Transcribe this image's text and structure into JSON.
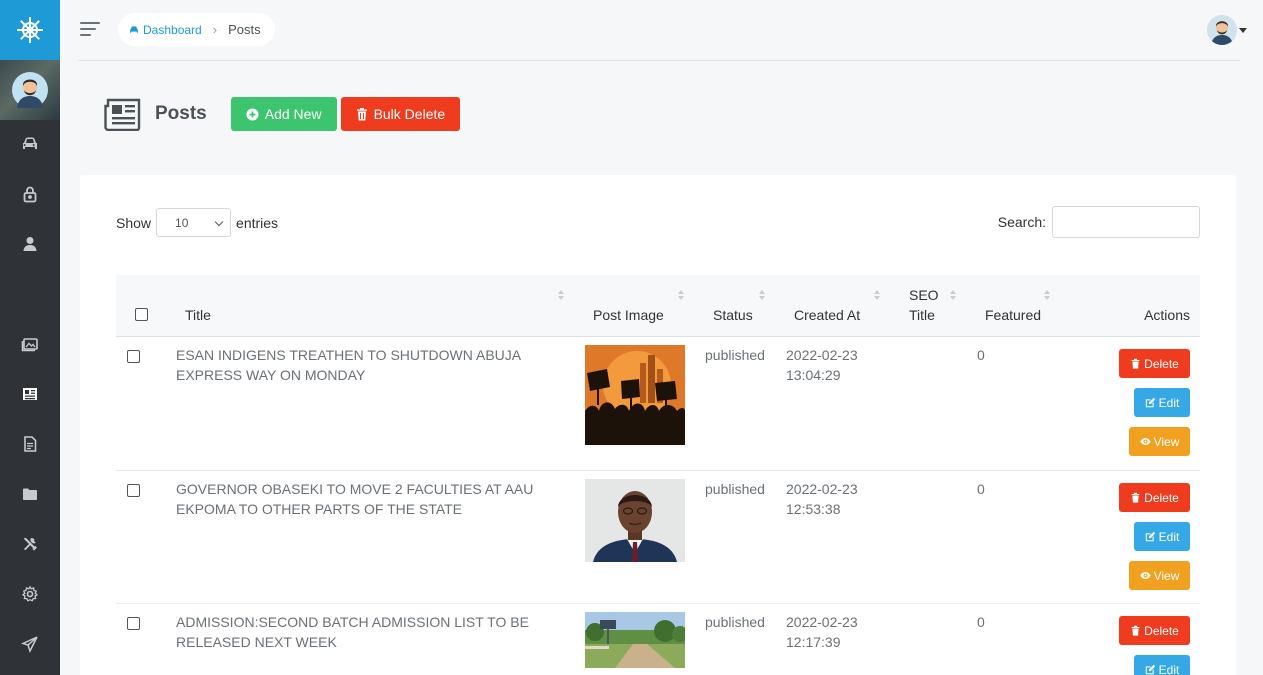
{
  "breadcrumb": {
    "home": "Dashboard",
    "current": "Posts"
  },
  "page": {
    "title": "Posts",
    "add_new": "Add New",
    "bulk_delete": "Bulk Delete"
  },
  "table_controls": {
    "show_label": "Show",
    "page_size": "10",
    "entries_label": "entries",
    "search_label": "Search:",
    "search_value": ""
  },
  "columns": {
    "title": "Title",
    "post_image": "Post Image",
    "status": "Status",
    "created_at": "Created At",
    "seo_title_1": "SEO",
    "seo_title_2": "Title",
    "featured": "Featured",
    "actions": "Actions"
  },
  "actions": {
    "delete": "Delete",
    "edit": "Edit",
    "view": "View"
  },
  "rows": [
    {
      "title": "ESAN INDIGENS TREATHEN TO SHUTDOWN ABUJA EXPRESS WAY ON MONDAY",
      "status": "published",
      "date": "2022-02-23",
      "time": "13:04:29",
      "seo_title": "",
      "featured": "0"
    },
    {
      "title": "GOVERNOR OBASEKI TO MOVE 2 FACULTIES AT AAU EKPOMA TO OTHER PARTS OF THE STATE",
      "status": "published",
      "date": "2022-02-23",
      "time": "12:53:38",
      "seo_title": "",
      "featured": "0"
    },
    {
      "title": "ADMISSION:SECOND BATCH ADMISSION LIST TO BE RELEASED NEXT WEEK",
      "status": "published",
      "date": "2022-02-23",
      "time": "12:17:39",
      "seo_title": "",
      "featured": "0"
    }
  ],
  "colors": {
    "brand": "#1e9ad6",
    "sidebar": "#2f3337",
    "success": "#3dc46e",
    "danger": "#ef3b1e",
    "info": "#35a8e6",
    "warning": "#f2a020"
  },
  "icons": [
    "ship-wheel-icon",
    "user-avatar-icon",
    "car-icon",
    "lock-icon",
    "user-icon",
    "images-icon",
    "newspaper-icon",
    "file-icon",
    "folder-icon",
    "tools-icon",
    "gear-icon",
    "paper-plane-icon",
    "plus-circle-icon",
    "trash-icon",
    "edit-icon",
    "eye-icon"
  ]
}
